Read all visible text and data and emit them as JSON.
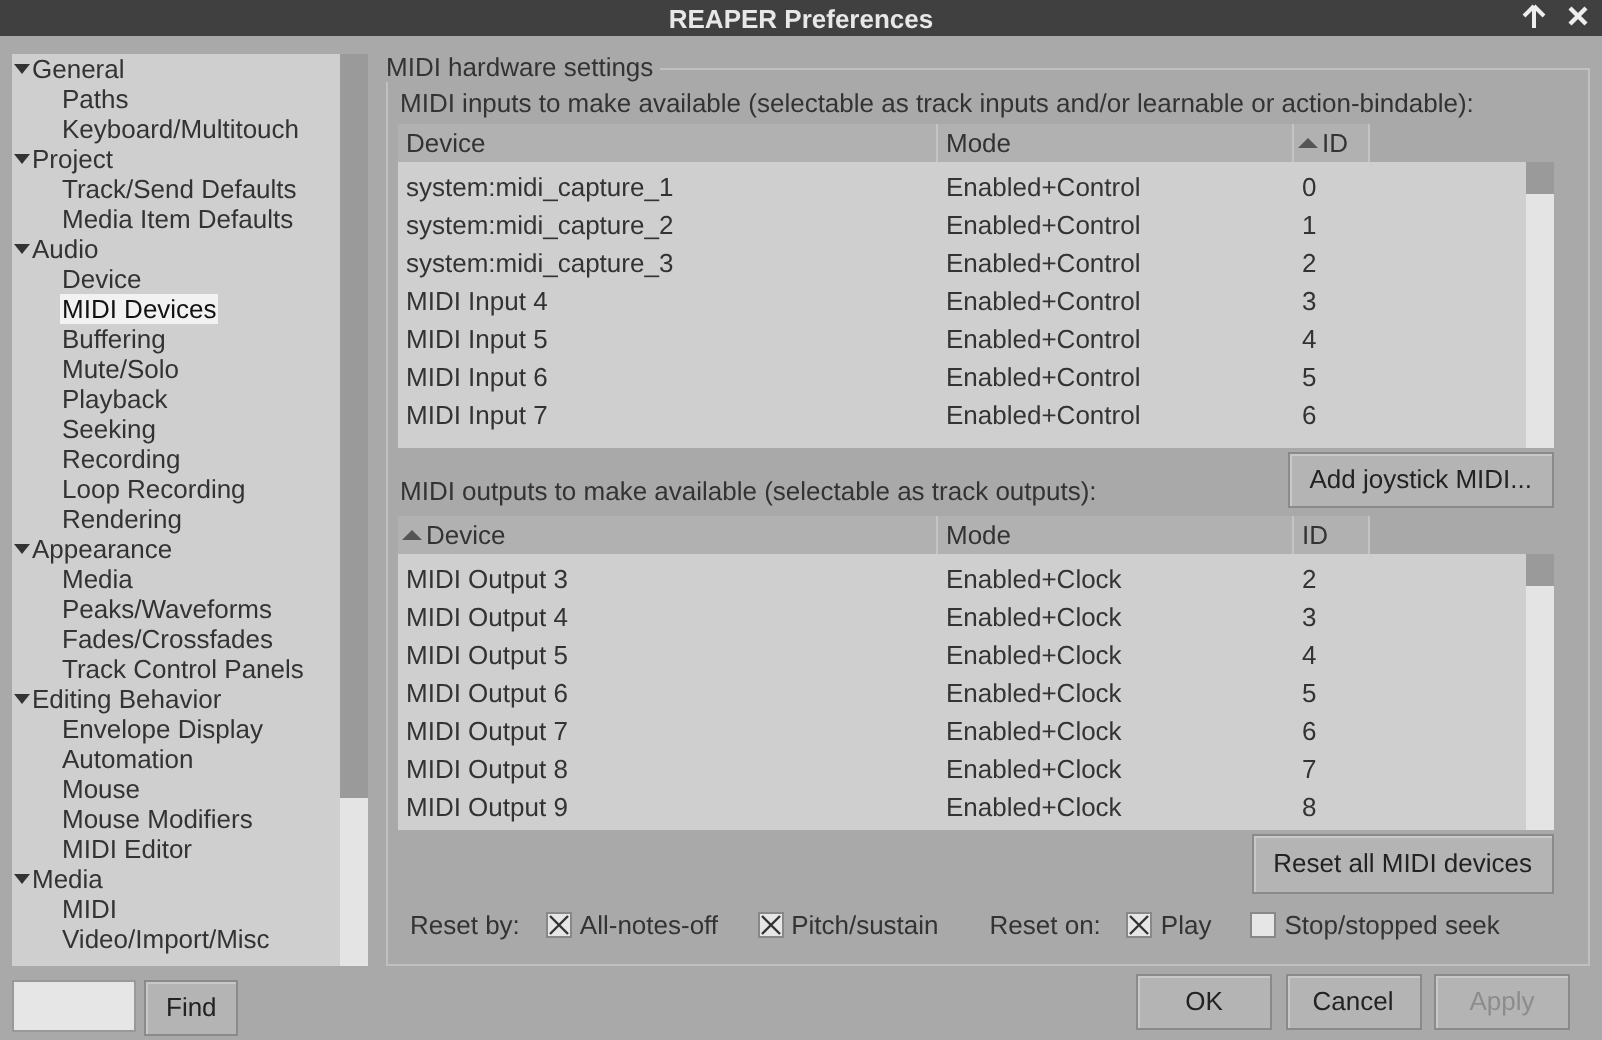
{
  "window": {
    "title": "REAPER Preferences"
  },
  "tree": [
    {
      "label": "General",
      "expanded": true,
      "selected": false,
      "children": [
        {
          "label": "Paths",
          "selected": false
        },
        {
          "label": "Keyboard/Multitouch",
          "selected": false
        }
      ]
    },
    {
      "label": "Project",
      "expanded": true,
      "selected": false,
      "children": [
        {
          "label": "Track/Send Defaults",
          "selected": false
        },
        {
          "label": "Media Item Defaults",
          "selected": false
        }
      ]
    },
    {
      "label": "Audio",
      "expanded": true,
      "selected": false,
      "children": [
        {
          "label": "Device",
          "selected": false
        },
        {
          "label": "MIDI Devices",
          "selected": true
        },
        {
          "label": "Buffering",
          "selected": false
        },
        {
          "label": "Mute/Solo",
          "selected": false
        },
        {
          "label": "Playback",
          "selected": false
        },
        {
          "label": "Seeking",
          "selected": false
        },
        {
          "label": "Recording",
          "selected": false
        },
        {
          "label": "Loop Recording",
          "selected": false
        },
        {
          "label": "Rendering",
          "selected": false
        }
      ]
    },
    {
      "label": "Appearance",
      "expanded": true,
      "selected": false,
      "children": [
        {
          "label": "Media",
          "selected": false
        },
        {
          "label": "Peaks/Waveforms",
          "selected": false
        },
        {
          "label": "Fades/Crossfades",
          "selected": false
        },
        {
          "label": "Track Control Panels",
          "selected": false
        }
      ]
    },
    {
      "label": "Editing Behavior",
      "expanded": true,
      "selected": false,
      "children": [
        {
          "label": "Envelope Display",
          "selected": false
        },
        {
          "label": "Automation",
          "selected": false
        },
        {
          "label": "Mouse",
          "selected": false
        },
        {
          "label": "Mouse Modifiers",
          "selected": false
        },
        {
          "label": "MIDI Editor",
          "selected": false
        }
      ]
    },
    {
      "label": "Media",
      "expanded": true,
      "selected": false,
      "children": [
        {
          "label": "MIDI",
          "selected": false
        },
        {
          "label": "Video/Import/Misc",
          "selected": false
        }
      ]
    }
  ],
  "find_button": "Find",
  "group_title": "MIDI hardware settings",
  "inputs": {
    "label": "MIDI inputs to make available (selectable as track inputs and/or learnable or action-bindable):",
    "columns": [
      {
        "label": "Device",
        "sorted": false
      },
      {
        "label": "Mode",
        "sorted": false
      },
      {
        "label": "ID",
        "sorted": true
      }
    ],
    "rows": [
      [
        "system:midi_capture_1",
        "Enabled+Control",
        "0"
      ],
      [
        "system:midi_capture_2",
        "Enabled+Control",
        "1"
      ],
      [
        "system:midi_capture_3",
        "Enabled+Control",
        "2"
      ],
      [
        "MIDI Input 4",
        "Enabled+Control",
        "3"
      ],
      [
        "MIDI Input 5",
        "Enabled+Control",
        "4"
      ],
      [
        "MIDI Input 6",
        "Enabled+Control",
        "5"
      ],
      [
        "MIDI Input 7",
        "Enabled+Control",
        "6"
      ]
    ]
  },
  "add_joystick_button": "Add joystick MIDI...",
  "outputs": {
    "label": "MIDI outputs to make available (selectable as track outputs):",
    "columns": [
      {
        "label": "Device",
        "sorted": true
      },
      {
        "label": "Mode",
        "sorted": false
      },
      {
        "label": "ID",
        "sorted": false
      }
    ],
    "rows": [
      [
        "MIDI Output 3",
        "Enabled+Clock",
        "2"
      ],
      [
        "MIDI Output 4",
        "Enabled+Clock",
        "3"
      ],
      [
        "MIDI Output 5",
        "Enabled+Clock",
        "4"
      ],
      [
        "MIDI Output 6",
        "Enabled+Clock",
        "5"
      ],
      [
        "MIDI Output 7",
        "Enabled+Clock",
        "6"
      ],
      [
        "MIDI Output 8",
        "Enabled+Clock",
        "7"
      ],
      [
        "MIDI Output 9",
        "Enabled+Clock",
        "8"
      ]
    ]
  },
  "reset_all_button": "Reset all MIDI devices",
  "reset_by": {
    "label": "Reset by:",
    "options": [
      {
        "label": "All-notes-off",
        "checked": true
      },
      {
        "label": "Pitch/sustain",
        "checked": true
      }
    ]
  },
  "reset_on": {
    "label": "Reset on:",
    "options": [
      {
        "label": "Play",
        "checked": true
      },
      {
        "label": "Stop/stopped seek",
        "checked": false
      }
    ]
  },
  "buttons": [
    {
      "label": "OK",
      "disabled": false
    },
    {
      "label": "Cancel",
      "disabled": false
    },
    {
      "label": "Apply",
      "disabled": true
    }
  ]
}
